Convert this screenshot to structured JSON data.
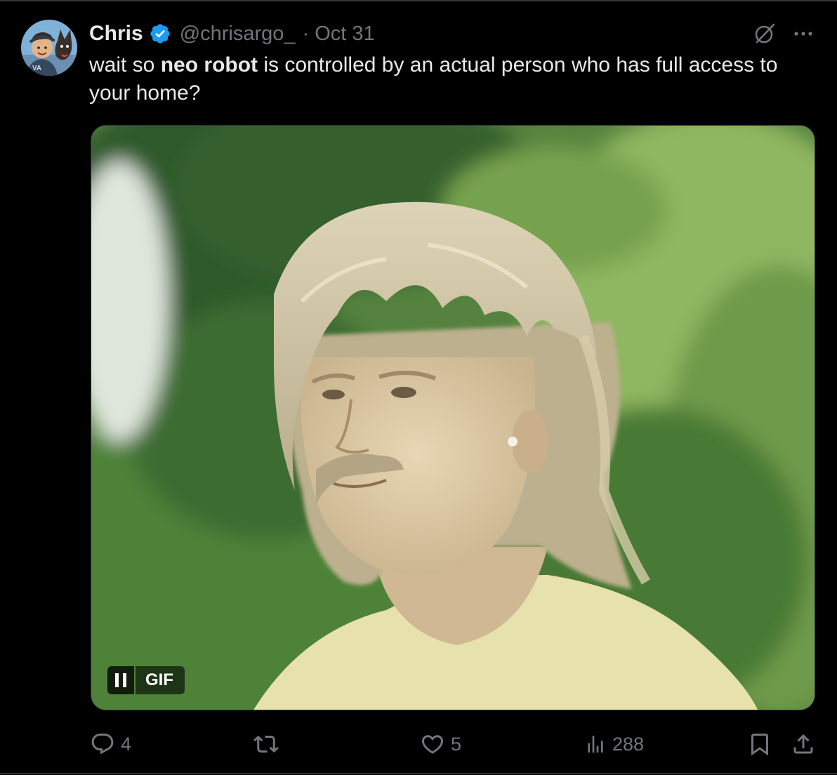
{
  "tweet": {
    "author_name": "Chris",
    "handle": "@chrisargo_",
    "separator": "·",
    "date": "Oct 31",
    "text_parts": [
      {
        "text": "wait so ",
        "bold": false
      },
      {
        "text": "neo robot",
        "bold": true
      },
      {
        "text": " is controlled by an actual person who has full access to your home?",
        "bold": false
      }
    ],
    "media": {
      "type": "gif",
      "badge_label": "GIF",
      "pause_icon": "pause-icon"
    }
  },
  "actions": {
    "replies": "4",
    "retweets": "",
    "likes": "5",
    "views": "288"
  },
  "icons": {
    "verified": "verified-badge-icon",
    "grok": "grok-icon",
    "more": "more-icon",
    "reply": "reply-icon",
    "retweet": "retweet-icon",
    "like": "heart-icon",
    "views": "views-icon",
    "bookmark": "bookmark-icon",
    "share": "share-icon"
  },
  "colors": {
    "background": "#000000",
    "text_primary": "#e7e9ea",
    "text_secondary": "#71767b",
    "verified_blue": "#1d9bf0",
    "border": "#2f3336"
  }
}
